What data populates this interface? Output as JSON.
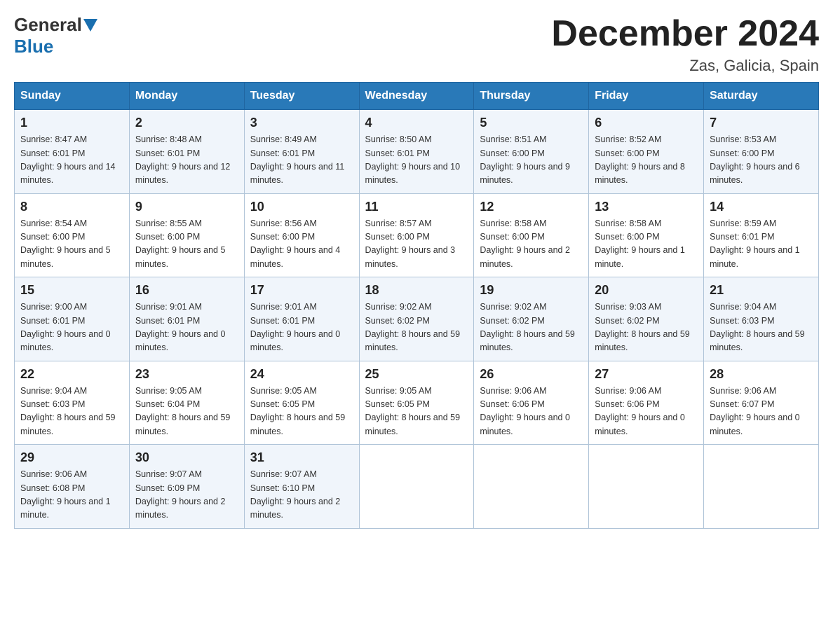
{
  "logo": {
    "text_general": "General",
    "text_blue": "Blue"
  },
  "title": "December 2024",
  "location": "Zas, Galicia, Spain",
  "headers": [
    "Sunday",
    "Monday",
    "Tuesday",
    "Wednesday",
    "Thursday",
    "Friday",
    "Saturday"
  ],
  "weeks": [
    [
      {
        "day": "1",
        "sunrise": "8:47 AM",
        "sunset": "6:01 PM",
        "daylight": "9 hours and 14 minutes."
      },
      {
        "day": "2",
        "sunrise": "8:48 AM",
        "sunset": "6:01 PM",
        "daylight": "9 hours and 12 minutes."
      },
      {
        "day": "3",
        "sunrise": "8:49 AM",
        "sunset": "6:01 PM",
        "daylight": "9 hours and 11 minutes."
      },
      {
        "day": "4",
        "sunrise": "8:50 AM",
        "sunset": "6:01 PM",
        "daylight": "9 hours and 10 minutes."
      },
      {
        "day": "5",
        "sunrise": "8:51 AM",
        "sunset": "6:00 PM",
        "daylight": "9 hours and 9 minutes."
      },
      {
        "day": "6",
        "sunrise": "8:52 AM",
        "sunset": "6:00 PM",
        "daylight": "9 hours and 8 minutes."
      },
      {
        "day": "7",
        "sunrise": "8:53 AM",
        "sunset": "6:00 PM",
        "daylight": "9 hours and 6 minutes."
      }
    ],
    [
      {
        "day": "8",
        "sunrise": "8:54 AM",
        "sunset": "6:00 PM",
        "daylight": "9 hours and 5 minutes."
      },
      {
        "day": "9",
        "sunrise": "8:55 AM",
        "sunset": "6:00 PM",
        "daylight": "9 hours and 5 minutes."
      },
      {
        "day": "10",
        "sunrise": "8:56 AM",
        "sunset": "6:00 PM",
        "daylight": "9 hours and 4 minutes."
      },
      {
        "day": "11",
        "sunrise": "8:57 AM",
        "sunset": "6:00 PM",
        "daylight": "9 hours and 3 minutes."
      },
      {
        "day": "12",
        "sunrise": "8:58 AM",
        "sunset": "6:00 PM",
        "daylight": "9 hours and 2 minutes."
      },
      {
        "day": "13",
        "sunrise": "8:58 AM",
        "sunset": "6:00 PM",
        "daylight": "9 hours and 1 minute."
      },
      {
        "day": "14",
        "sunrise": "8:59 AM",
        "sunset": "6:01 PM",
        "daylight": "9 hours and 1 minute."
      }
    ],
    [
      {
        "day": "15",
        "sunrise": "9:00 AM",
        "sunset": "6:01 PM",
        "daylight": "9 hours and 0 minutes."
      },
      {
        "day": "16",
        "sunrise": "9:01 AM",
        "sunset": "6:01 PM",
        "daylight": "9 hours and 0 minutes."
      },
      {
        "day": "17",
        "sunrise": "9:01 AM",
        "sunset": "6:01 PM",
        "daylight": "9 hours and 0 minutes."
      },
      {
        "day": "18",
        "sunrise": "9:02 AM",
        "sunset": "6:02 PM",
        "daylight": "8 hours and 59 minutes."
      },
      {
        "day": "19",
        "sunrise": "9:02 AM",
        "sunset": "6:02 PM",
        "daylight": "8 hours and 59 minutes."
      },
      {
        "day": "20",
        "sunrise": "9:03 AM",
        "sunset": "6:02 PM",
        "daylight": "8 hours and 59 minutes."
      },
      {
        "day": "21",
        "sunrise": "9:04 AM",
        "sunset": "6:03 PM",
        "daylight": "8 hours and 59 minutes."
      }
    ],
    [
      {
        "day": "22",
        "sunrise": "9:04 AM",
        "sunset": "6:03 PM",
        "daylight": "8 hours and 59 minutes."
      },
      {
        "day": "23",
        "sunrise": "9:05 AM",
        "sunset": "6:04 PM",
        "daylight": "8 hours and 59 minutes."
      },
      {
        "day": "24",
        "sunrise": "9:05 AM",
        "sunset": "6:05 PM",
        "daylight": "8 hours and 59 minutes."
      },
      {
        "day": "25",
        "sunrise": "9:05 AM",
        "sunset": "6:05 PM",
        "daylight": "8 hours and 59 minutes."
      },
      {
        "day": "26",
        "sunrise": "9:06 AM",
        "sunset": "6:06 PM",
        "daylight": "9 hours and 0 minutes."
      },
      {
        "day": "27",
        "sunrise": "9:06 AM",
        "sunset": "6:06 PM",
        "daylight": "9 hours and 0 minutes."
      },
      {
        "day": "28",
        "sunrise": "9:06 AM",
        "sunset": "6:07 PM",
        "daylight": "9 hours and 0 minutes."
      }
    ],
    [
      {
        "day": "29",
        "sunrise": "9:06 AM",
        "sunset": "6:08 PM",
        "daylight": "9 hours and 1 minute."
      },
      {
        "day": "30",
        "sunrise": "9:07 AM",
        "sunset": "6:09 PM",
        "daylight": "9 hours and 2 minutes."
      },
      {
        "day": "31",
        "sunrise": "9:07 AM",
        "sunset": "6:10 PM",
        "daylight": "9 hours and 2 minutes."
      },
      null,
      null,
      null,
      null
    ]
  ],
  "labels": {
    "sunrise": "Sunrise:",
    "sunset": "Sunset:",
    "daylight": "Daylight:"
  }
}
